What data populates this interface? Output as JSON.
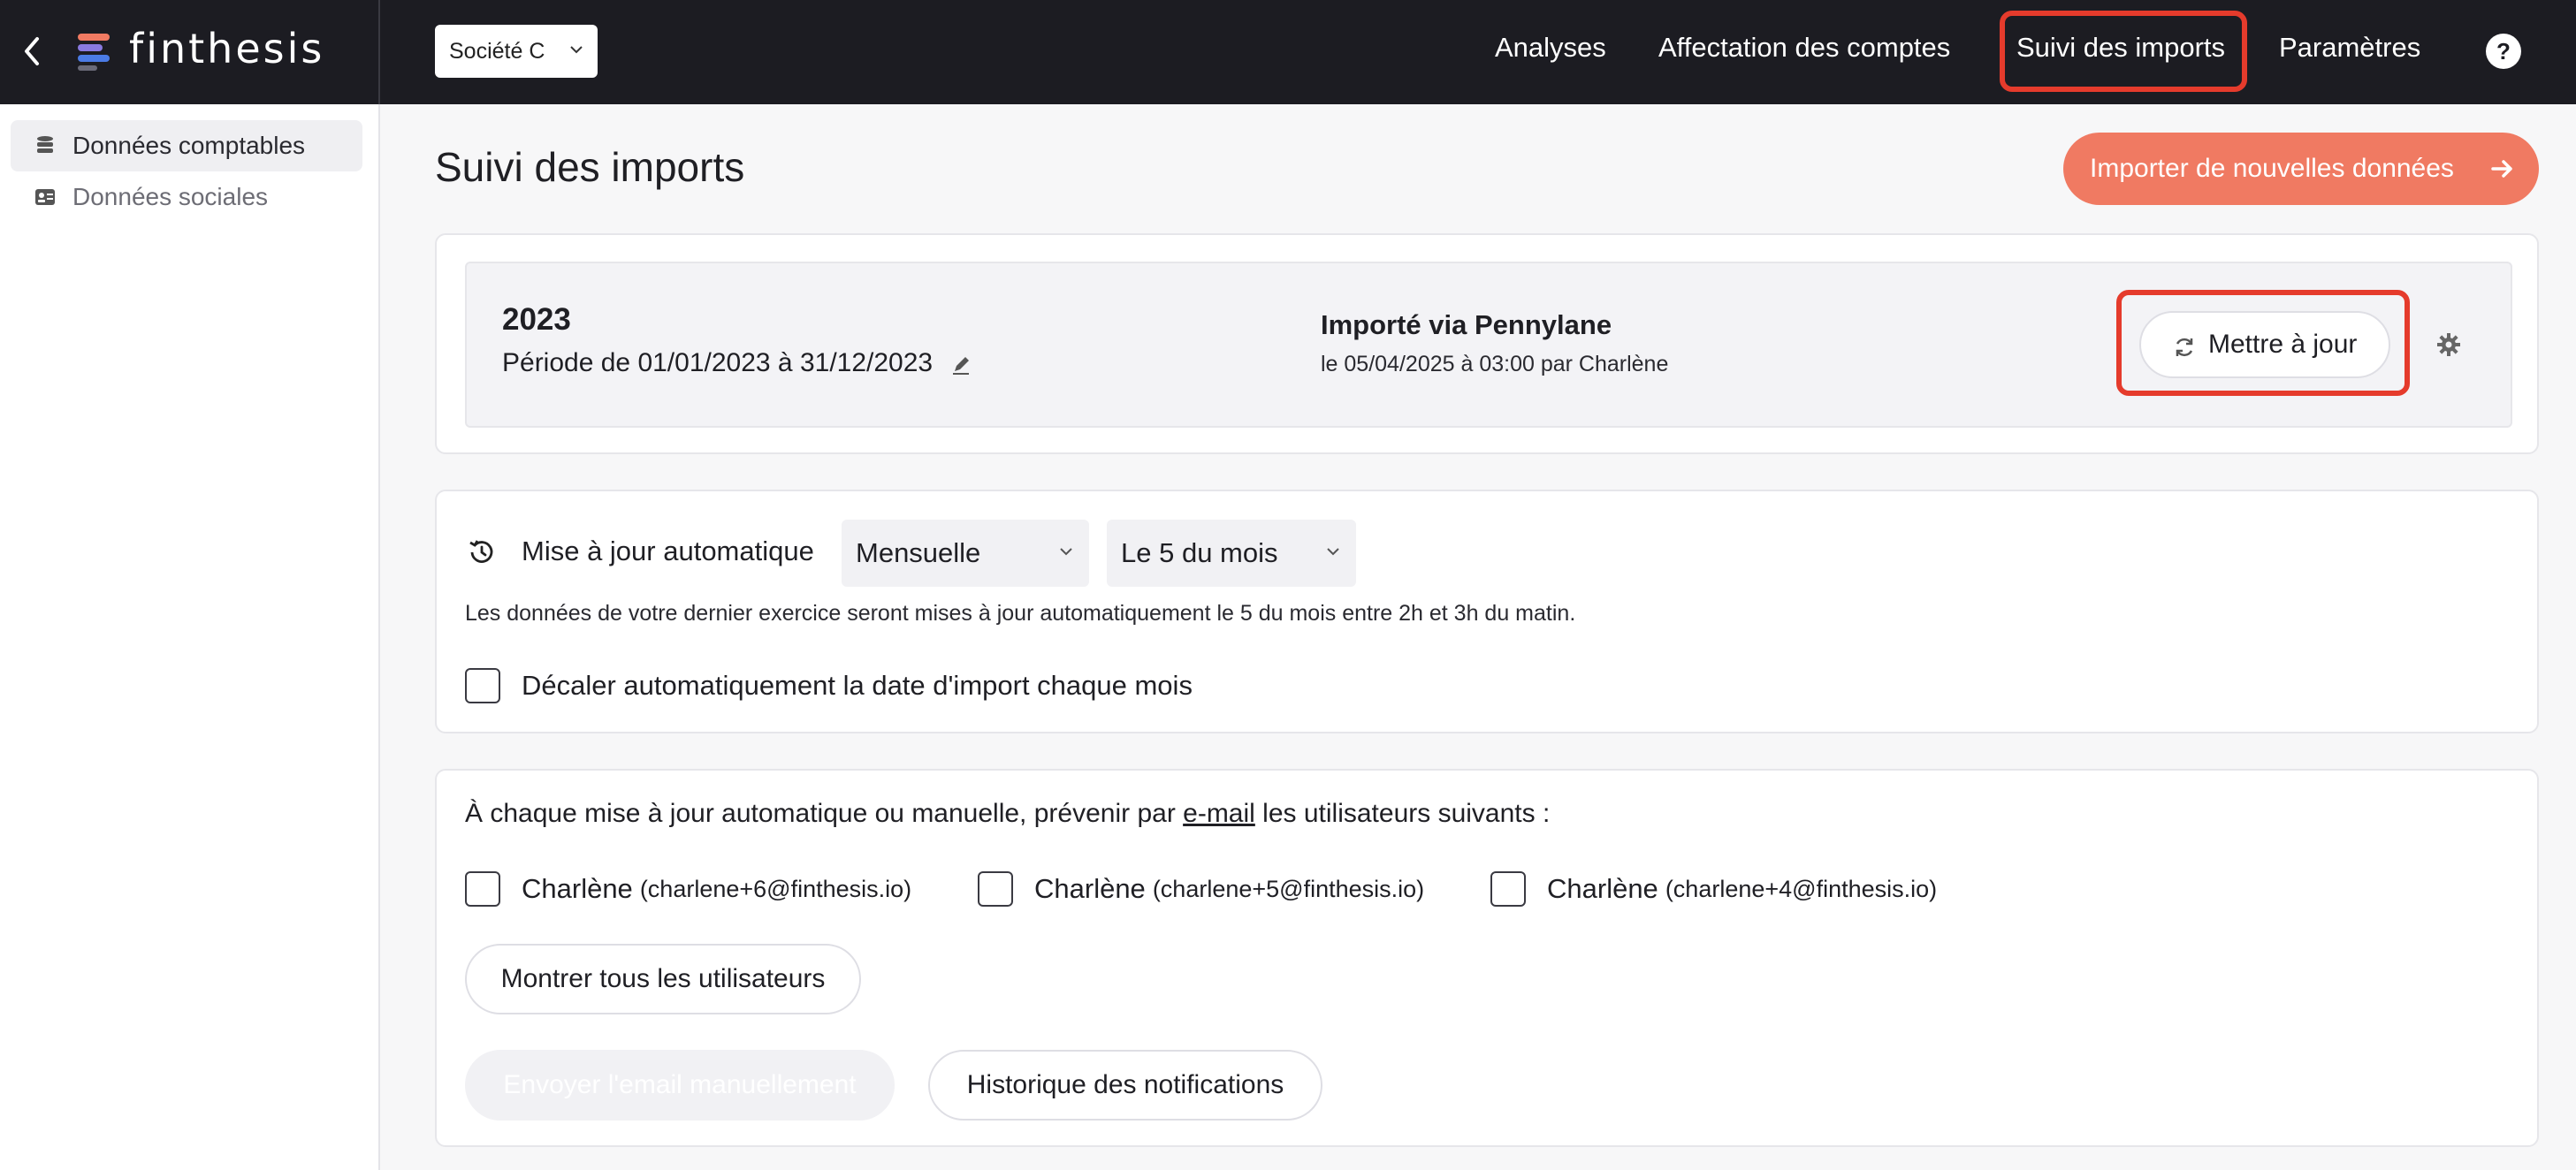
{
  "app": {
    "brand": "finthesis",
    "company": "Société C"
  },
  "nav": {
    "items": [
      {
        "label": "Analyses"
      },
      {
        "label": "Affectation des comptes"
      },
      {
        "label": "Suivi des imports"
      },
      {
        "label": "Paramètres"
      }
    ],
    "help": "?"
  },
  "sidebar": {
    "items": [
      {
        "label": "Données comptables",
        "icon": "database-icon"
      },
      {
        "label": "Données sociales",
        "icon": "id-card-icon"
      }
    ]
  },
  "page": {
    "title": "Suivi des imports",
    "import_button": "Importer de nouvelles données"
  },
  "period": {
    "year": "2023",
    "range": "Période de 01/01/2023 à 31/12/2023",
    "imported_via": "Importé via Pennylane",
    "imported_date": "le 05/04/2025 à 03:00 par Charlène",
    "update_button": "Mettre à jour"
  },
  "auto_update": {
    "label": "Mise à jour automatique",
    "frequency": "Mensuelle",
    "day": "Le 5 du mois",
    "description": "Les données de votre dernier exercice seront mises à jour automatiquement le 5 du mois entre 2h et 3h du matin.",
    "shift_label": "Décaler automatiquement la date d'import chaque mois"
  },
  "notifications": {
    "text_before": "À chaque mise à jour automatique ou manuelle, prévenir par ",
    "link": "e-mail",
    "text_after": " les utilisateurs suivants :",
    "users": [
      {
        "name": "Charlène",
        "email": "(charlene+6@finthesis.io)"
      },
      {
        "name": "Charlène",
        "email": "(charlene+5@finthesis.io)"
      },
      {
        "name": "Charlène",
        "email": "(charlene+4@finthesis.io)"
      }
    ],
    "show_all": "Montrer tous les utilisateurs",
    "send_email": "Envoyer l'email manuellement",
    "history": "Historique des notifications"
  },
  "colors": {
    "topbar": "#1c1c22",
    "accent": "#f07a62",
    "highlight": "#e53b2c"
  }
}
